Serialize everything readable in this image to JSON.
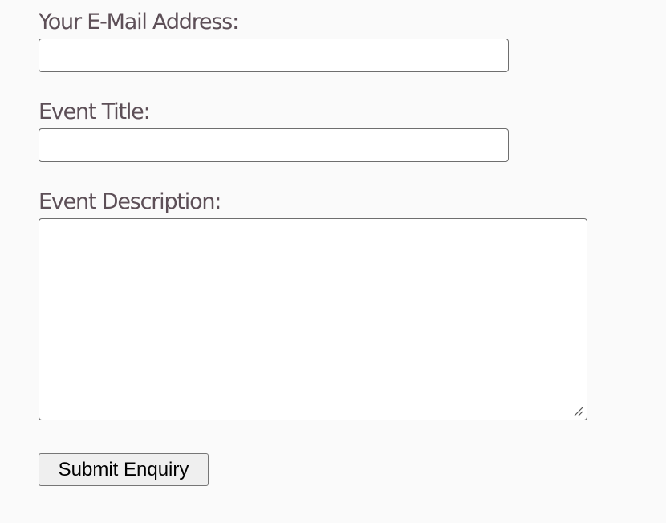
{
  "form": {
    "email": {
      "label": "Your E-Mail Address:",
      "value": "",
      "placeholder": ""
    },
    "title": {
      "label": "Event Title:",
      "value": "",
      "placeholder": ""
    },
    "description": {
      "label": "Event Description:",
      "value": "",
      "placeholder": ""
    },
    "submit_label": "Submit Enquiry"
  },
  "colors": {
    "background": "#fafafa",
    "label_text": "#5d4f57",
    "field_border": "#6e6e6e",
    "button_background": "#efefef"
  },
  "icons": {
    "resize_handle": "resize-handle-icon"
  }
}
